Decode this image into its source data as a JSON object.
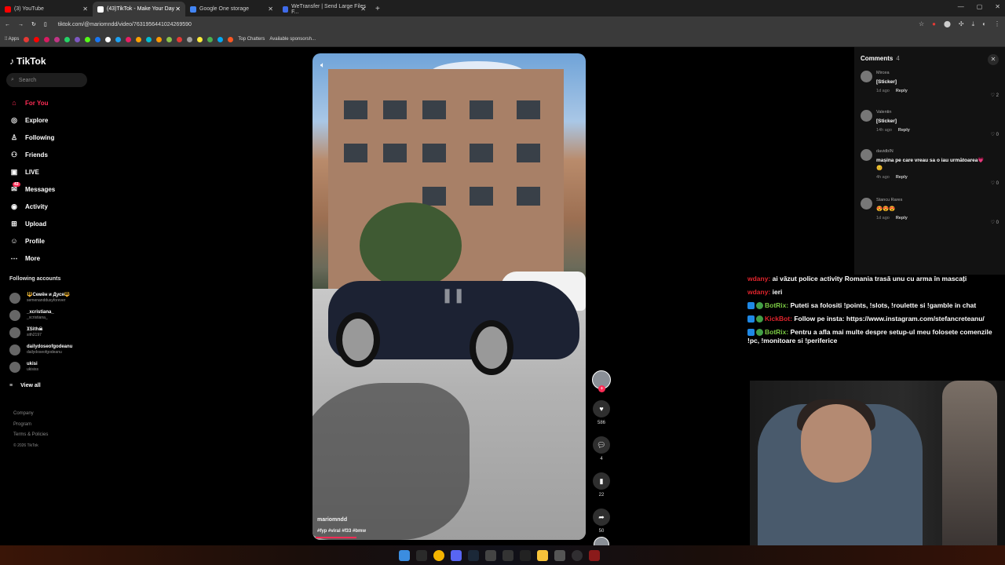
{
  "browser": {
    "tabs": [
      {
        "label": "(3) YouTube",
        "color": "#ff0000"
      },
      {
        "label": "(43)TikTok - Make Your Day",
        "color": "#ffffff"
      },
      {
        "label": "Google One storage",
        "color": "#4285f4"
      },
      {
        "label": "WeTransfer | Send Large Files F...",
        "color": "#3f6bea"
      }
    ],
    "url": "tiktok.com/@mariomndd/video/7631956441024269590",
    "bookmarks": {
      "apps": "Apps",
      "top_chatters": "Top Chatters",
      "sponsorship": "Available sponsorsh..."
    }
  },
  "sidebar": {
    "logo": "TikTok",
    "search_placeholder": "Search",
    "nav": [
      {
        "label": "For You",
        "icon": "home-icon",
        "glyph": "⌂"
      },
      {
        "label": "Explore",
        "icon": "compass-icon",
        "glyph": "◎"
      },
      {
        "label": "Following",
        "icon": "following-icon",
        "glyph": "♙"
      },
      {
        "label": "Friends",
        "icon": "friends-icon",
        "glyph": "⚇"
      },
      {
        "label": "LIVE",
        "icon": "live-icon",
        "glyph": "▣"
      },
      {
        "label": "Messages",
        "icon": "messages-icon",
        "glyph": "✉",
        "badge": "43"
      },
      {
        "label": "Activity",
        "icon": "activity-icon",
        "glyph": "◉"
      },
      {
        "label": "Upload",
        "icon": "upload-icon",
        "glyph": "⊞"
      },
      {
        "label": "Profile",
        "icon": "profile-icon",
        "glyph": "☺"
      },
      {
        "label": "More",
        "icon": "more-icon",
        "glyph": "⋯"
      }
    ],
    "following_title": "Following accounts",
    "following": [
      {
        "name": "🔱Семён и Дуся🔱",
        "handle": "semenanddusyforever"
      },
      {
        "name": "_xcristiana_",
        "handle": "_xcristiana_"
      },
      {
        "name": "ꘉSith☠",
        "handle": "sith2197"
      },
      {
        "name": "dailydoseofgodeanu",
        "handle": "dailydoseofgodeanu"
      },
      {
        "name": "ukisi",
        "handle": "ukisiss"
      }
    ],
    "view_all": "View all",
    "footer": [
      "Company",
      "Program",
      "Terms & Policies"
    ],
    "copyright": "© 2026 TikTok"
  },
  "video": {
    "username": "mariomndd",
    "tags": "#fyp #viral #f33 #bmw",
    "progress_fraction": 0.15
  },
  "actions": {
    "likes": "586",
    "comments": "4",
    "saves": "22",
    "shares": "50"
  },
  "comments_panel": {
    "title": "Comments",
    "count": "4",
    "items": [
      {
        "user": "Mircea",
        "text": "[Sticker]",
        "time": "1d ago",
        "reply": "Reply",
        "likes": "2"
      },
      {
        "user": "Valentin",
        "text": "[Sticker]",
        "time": "14h ago",
        "reply": "Reply",
        "likes": "0"
      },
      {
        "user": "davidbIN",
        "text": "mașina pe care vreau sa o iau următoarea💗😊",
        "time": "4h ago",
        "reply": "Reply",
        "likes": "0"
      },
      {
        "user": "Stancu Rares",
        "text": "😍😍😍",
        "time": "1d ago",
        "reply": "Reply",
        "likes": "0"
      }
    ]
  },
  "stream_chat": [
    {
      "user": "wdany:",
      "text": "ai văzut police activity Romania trasă unu cu arma în mascați",
      "user_color": "#e0242c"
    },
    {
      "user": "wdany:",
      "text": "ieri",
      "user_color": "#e0242c"
    },
    {
      "user": "BotRix:",
      "text": "Puteti sa folositi !points, !slots, !roulette si !gamble in chat",
      "user_color": "#7ac943"
    },
    {
      "user": "KickBot:",
      "text": "Follow pe insta: https://www.instagram.com/stefancreteanu/",
      "user_color": "#e0242c"
    },
    {
      "user": "BotRix:",
      "text": "Pentru a afla mai multe despre setup-ul meu folosete comenzile !pc, !monitoare si !periferice",
      "user_color": "#7ac943"
    }
  ],
  "colors": {
    "accent": "#fe2c55",
    "panel": "#121212"
  }
}
